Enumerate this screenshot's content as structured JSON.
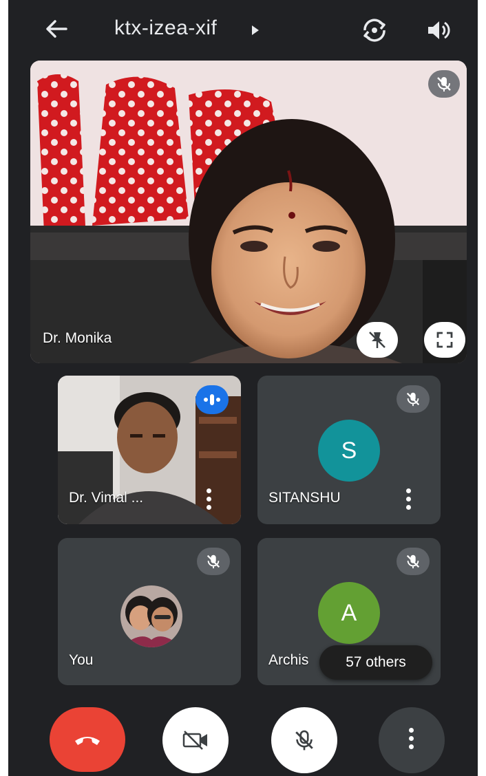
{
  "header": {
    "meeting_code": "ktx-izea-xif",
    "icons": [
      "back-arrow-icon",
      "caret-right-icon",
      "switch-camera-icon",
      "speaker-icon"
    ]
  },
  "main_tile": {
    "participant_name": "Dr. Monika",
    "icons": [
      "mic-off-icon",
      "unpin-icon",
      "fullscreen-icon"
    ]
  },
  "participants": [
    {
      "name": "Dr. Vimal ...",
      "state": "speaking",
      "video": "on"
    },
    {
      "name": "SITANSHU",
      "avatar_letter": "S",
      "avatar_color": "#12939a",
      "muted": true
    },
    {
      "name": "You",
      "avatar": "photo",
      "muted": true
    },
    {
      "name": "Archis",
      "avatar_letter": "A",
      "avatar_color": "#63a033",
      "muted": true
    }
  ],
  "others_badge": "57 others",
  "controls": {
    "end_call_color": "#ea4335",
    "buttons": [
      "end-call-icon",
      "camera-off-icon",
      "mic-off-icon",
      "more-options-icon"
    ]
  }
}
